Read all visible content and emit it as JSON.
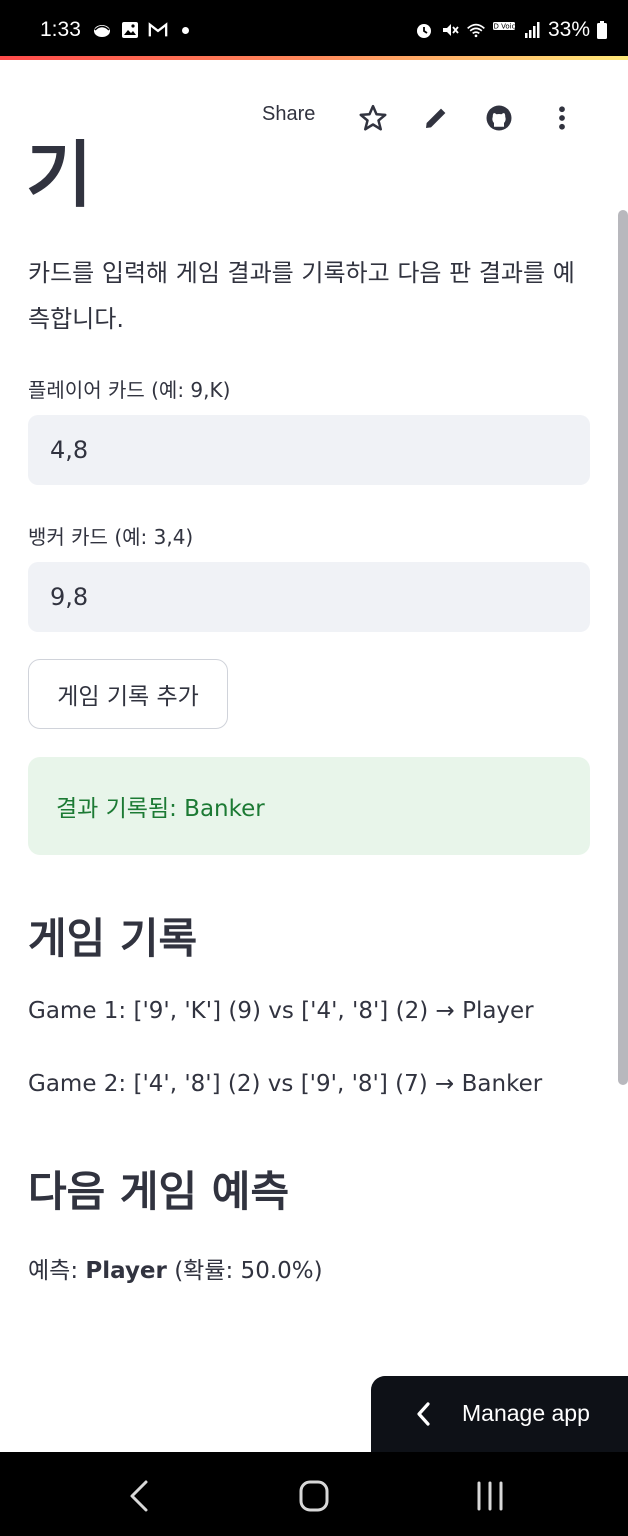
{
  "status_bar": {
    "time": "1:33",
    "left_icons": [
      "cloud-icon",
      "image-icon",
      "gmail-icon"
    ],
    "right_icons": [
      "alarm-icon",
      "mute-icon",
      "wifi-icon",
      "hd-voice-icon",
      "signal-icon"
    ],
    "hd_voice_label": "HD Voice",
    "battery": "33%"
  },
  "toolbar": {
    "share_label": "Share",
    "icons": [
      "star-icon",
      "edit-icon",
      "github-icon",
      "more-vertical-icon"
    ]
  },
  "main": {
    "partial_title": "기",
    "intro": "카드를 입력해 게임 결과를 기록하고 다음 판 결과를 예측합니다.",
    "player_field": {
      "label": "플레이어 카드 (예: 9,K)",
      "value": "4,8"
    },
    "banker_field": {
      "label": "뱅커 카드 (예: 3,4)",
      "value": "9,8"
    },
    "add_button_label": "게임 기록 추가",
    "success_message": "결과 기록됨: Banker",
    "history_heading": "게임 기록",
    "history": [
      "Game 1: ['9', 'K'] (9) vs ['4', '8'] (2) → Player",
      "Game 2: ['4', '8'] (2) vs ['9', '8'] (7) → Banker"
    ],
    "prediction_heading": "다음 게임 예측",
    "prediction": {
      "prefix": "예측: ",
      "result": "Player",
      "suffix": " (확률: 50.0%)"
    }
  },
  "manage_app": {
    "label": "Manage app"
  },
  "colors": {
    "accent_gradient": [
      "#ff4b4b",
      "#ff8a5c",
      "#ffe97a"
    ],
    "success_bg": "#e8f5ea",
    "success_text": "#1c7a34",
    "text": "#31333f",
    "input_bg": "#f0f2f6"
  }
}
